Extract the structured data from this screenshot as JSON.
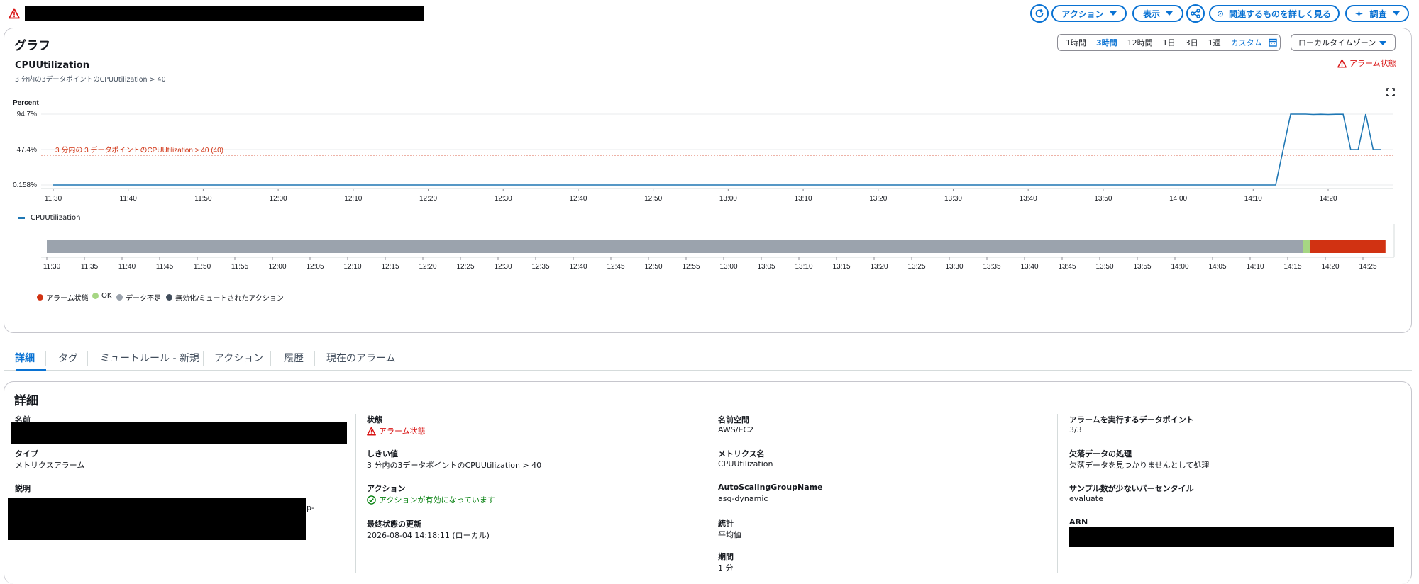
{
  "header": {
    "actions_label": "アクション",
    "view_label": "表示",
    "explore_label": "関連するものを詳しく見る",
    "investigate_label": "調査"
  },
  "graph": {
    "title": "グラフ",
    "ranges": [
      "1時間",
      "3時間",
      "12時間",
      "1日",
      "3日",
      "1週"
    ],
    "active_range": "3時間",
    "custom_label": "カスタム",
    "timezone": "ローカルタイムゾーン",
    "metric_title": "CPUUtilization",
    "metric_subtitle": "3 分内の3データポイントのCPUUtilization > 40",
    "alarm_state_label": "アラーム状態",
    "threshold_label": "3 分内の 3 データポイントのCPUUtilization > 40 (40)",
    "legend_series": "CPUUtilization",
    "timeline_legend": {
      "alarm": "アラーム状態",
      "ok": "OK",
      "insufficient": "データ不足",
      "muted": "無効化/ミュートされたアクション"
    }
  },
  "chart_data": {
    "type": "line",
    "ylabel": "Percent",
    "y_ticks": [
      "94.7%",
      "47.4%",
      "0.158%"
    ],
    "ylim": [
      0.158,
      94.7
    ],
    "x_ticks": [
      "11:30",
      "11:40",
      "11:50",
      "12:00",
      "12:10",
      "12:20",
      "12:30",
      "12:40",
      "12:50",
      "13:00",
      "13:10",
      "13:20",
      "13:30",
      "13:40",
      "13:50",
      "14:00",
      "14:10",
      "14:20"
    ],
    "threshold": 40,
    "series": [
      {
        "name": "CPUUtilization",
        "color": "#1f77b4",
        "x": [
          "11:30",
          "14:13",
          "14:15",
          "14:17",
          "14:18",
          "14:19",
          "14:20",
          "14:21",
          "14:22",
          "14:23",
          "14:24",
          "14:25",
          "14:26",
          "14:27"
        ],
        "values": [
          0.158,
          0.158,
          94.7,
          94.7,
          94.2,
          94.5,
          94.2,
          94.5,
          94.5,
          47.4,
          47.4,
          94.7,
          47.4,
          47.4
        ]
      }
    ],
    "state_timeline": {
      "ticks": [
        "11:30",
        "11:35",
        "11:40",
        "11:45",
        "11:50",
        "11:55",
        "12:00",
        "12:05",
        "12:10",
        "12:15",
        "12:20",
        "12:25",
        "12:30",
        "12:35",
        "12:40",
        "12:45",
        "12:50",
        "12:55",
        "13:00",
        "13:05",
        "13:10",
        "13:15",
        "13:20",
        "13:25",
        "13:30",
        "13:35",
        "13:40",
        "13:45",
        "13:50",
        "13:55",
        "14:00",
        "14:05",
        "14:10",
        "14:15",
        "14:20",
        "14:25"
      ],
      "segments": [
        {
          "state": "insufficient",
          "from": "11:30",
          "to": "14:17",
          "color": "#9ba3ad"
        },
        {
          "state": "ok",
          "from": "14:17",
          "to": "14:18",
          "color": "#a6d683"
        },
        {
          "state": "alarm",
          "from": "14:18",
          "to": "14:28",
          "color": "#d13212"
        }
      ]
    }
  },
  "tabs": [
    {
      "label": "詳細",
      "active": true
    },
    {
      "label": "タグ"
    },
    {
      "label": "ミュートルール - 新規"
    },
    {
      "label": "アクション"
    },
    {
      "label": "履歴"
    },
    {
      "label": "現在のアラーム"
    }
  ],
  "details": {
    "title": "詳細",
    "col1": {
      "name_label": "名前",
      "type_label": "タイプ",
      "type_value": "メトリクスアラーム",
      "description_label": "説明",
      "description_tail": "p-"
    },
    "col2": {
      "state_label": "状態",
      "state_value": "アラーム状態",
      "threshold_label": "しきい値",
      "threshold_value": "3 分内の3データポイントのCPUUtilization > 40",
      "actions_label": "アクション",
      "actions_value": "アクションが有効になっています",
      "last_update_label": "最終状態の更新",
      "last_update_value": "2026-08-04 14:18:11 (ローカル)"
    },
    "col3": {
      "namespace_label": "名前空間",
      "namespace_value": "AWS/EC2",
      "metric_name_label": "メトリクス名",
      "metric_name_value": "CPUUtilization",
      "asg_label": "AutoScalingGroupName",
      "asg_value": "asg-dynamic",
      "statistic_label": "統計",
      "statistic_value": "平均値",
      "period_label": "期間",
      "period_value": "1 分"
    },
    "col4": {
      "datapoints_label": "アラームを実行するデータポイント",
      "datapoints_value": "3/3",
      "missing_label": "欠落データの処理",
      "missing_value": "欠落データを見つかりませんとして処理",
      "percentile_label": "サンプル数が少ないパーセンタイル",
      "percentile_value": "evaluate",
      "arn_label": "ARN"
    }
  }
}
